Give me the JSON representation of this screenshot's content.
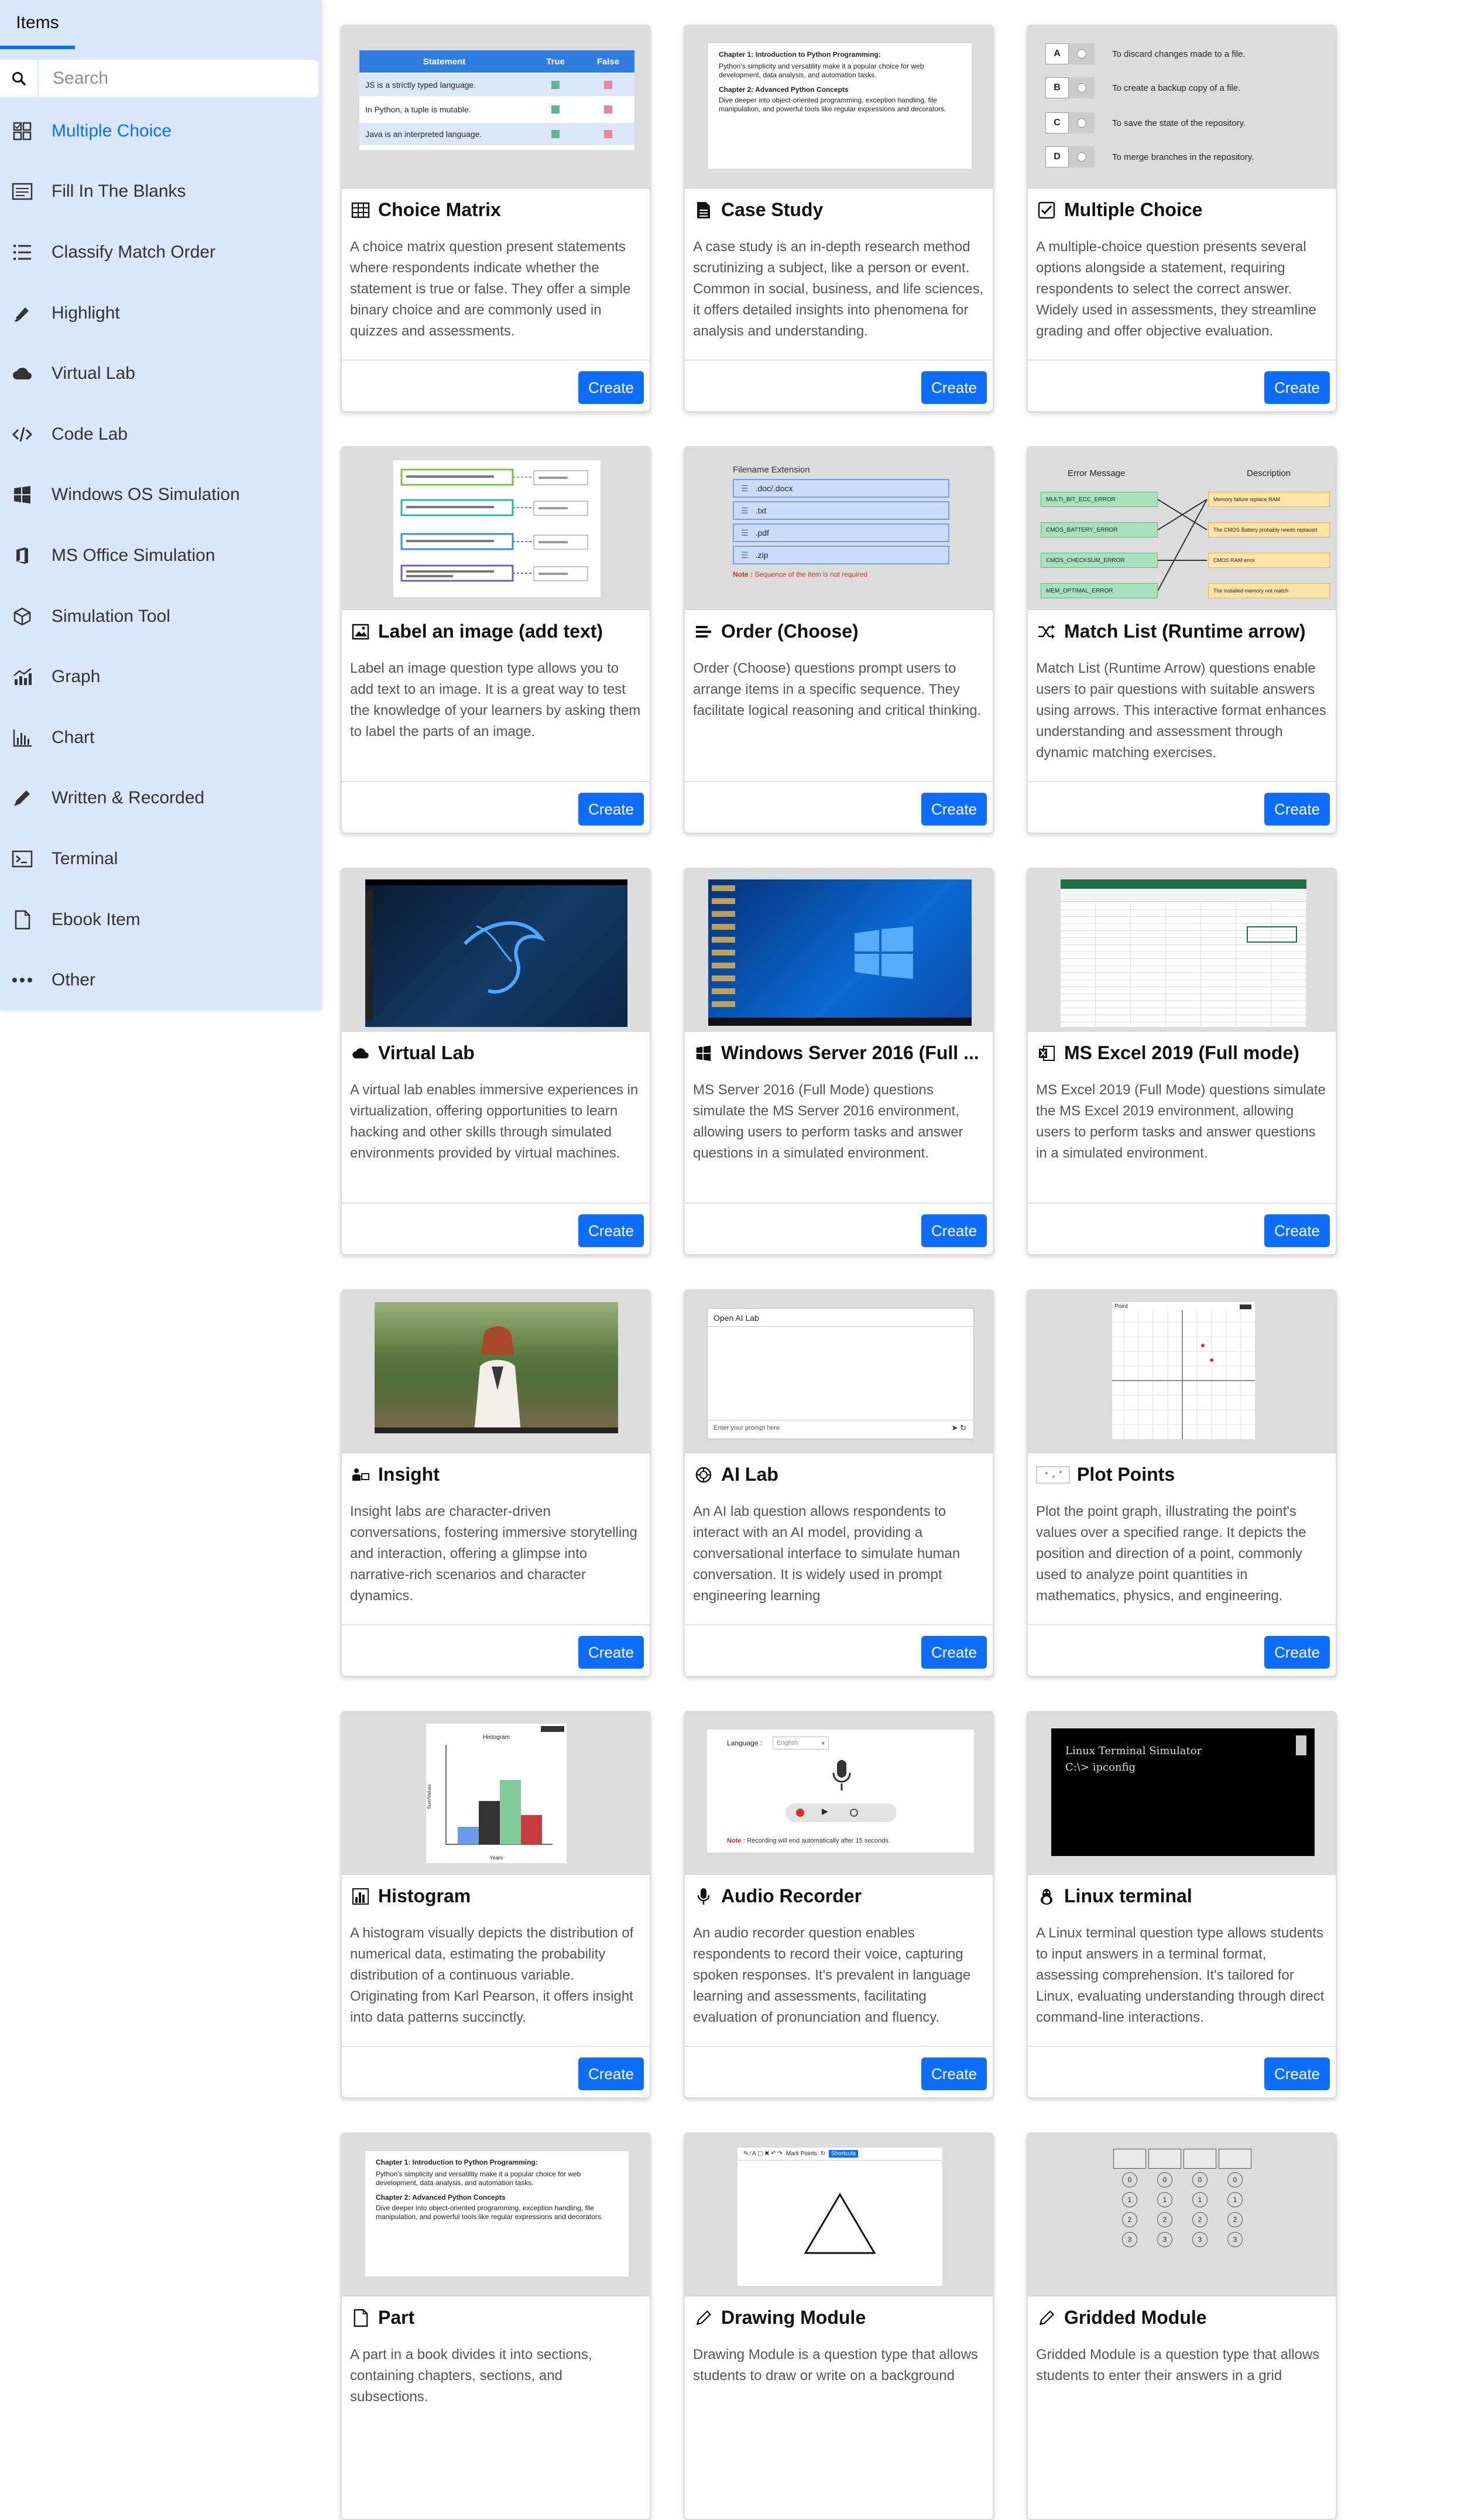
{
  "sidebar": {
    "tab_label": "Items",
    "search": {
      "placeholder": "Search",
      "icon": "search-icon"
    },
    "items": [
      {
        "label": "Multiple Choice",
        "icon": "multiple-choice-icon",
        "active": true
      },
      {
        "label": "Fill In The Blanks",
        "icon": "fill-blanks-icon"
      },
      {
        "label": "Classify Match Order",
        "icon": "list-icon"
      },
      {
        "label": "Highlight",
        "icon": "highlighter-icon"
      },
      {
        "label": "Virtual Lab",
        "icon": "cloud-icon"
      },
      {
        "label": "Code Lab",
        "icon": "code-icon"
      },
      {
        "label": "Windows OS Simulation",
        "icon": "windows-icon"
      },
      {
        "label": "MS Office Simulation",
        "icon": "office-icon"
      },
      {
        "label": "Simulation Tool",
        "icon": "cube-icon"
      },
      {
        "label": "Graph",
        "icon": "graph-icon"
      },
      {
        "label": "Chart",
        "icon": "chart-icon"
      },
      {
        "label": "Written & Recorded",
        "icon": "pencil-icon"
      },
      {
        "label": "Terminal",
        "icon": "terminal-icon"
      },
      {
        "label": "Ebook Item",
        "icon": "page-icon"
      },
      {
        "label": "Other",
        "icon": "more-icon"
      }
    ]
  },
  "create_label": "Create",
  "cards": [
    {
      "title": "Choice Matrix",
      "icon": "table-icon",
      "desc": "A choice matrix question present statements where respondents indicate whether the statement is true or false. They offer a simple binary choice and are commonly used in quizzes and assessments."
    },
    {
      "title": "Case Study",
      "icon": "document-icon",
      "desc": "A case study is an in-depth research method scrutinizing a subject, like a person or event. Common in social, business, and life sciences, it offers detailed insights into phenomena for analysis and understanding."
    },
    {
      "title": "Multiple Choice",
      "icon": "checkbox-icon",
      "desc": "A multiple-choice question presents several options alongside a statement, requiring respondents to select the correct answer. Widely used in assessments, they streamline grading and offer objective evaluation."
    },
    {
      "title": "Label an image (add text)",
      "icon": "image-icon",
      "desc": "Label an image question type allows you to add text to an image. It is a great way to test the knowledge of your learners by asking them to label the parts of an image."
    },
    {
      "title": "Order (Choose)",
      "icon": "order-list-icon",
      "desc": "Order (Choose) questions prompt users to arrange items in a specific sequence. They facilitate logical reasoning and critical thinking."
    },
    {
      "title": "Match List (Runtime arrow)",
      "icon": "shuffle-icon",
      "desc": "Match List (Runtime Arrow) questions enable users to pair questions with suitable answers using arrows. This interactive format enhances understanding and assessment through dynamic matching exercises."
    },
    {
      "title": "Virtual Lab",
      "icon": "cloud-icon",
      "desc": "A virtual lab enables immersive experiences in virtualization, offering opportunities to learn hacking and other skills through simulated environments provided by virtual machines."
    },
    {
      "title": "Windows Server 2016 (Full ...",
      "icon": "windows-icon",
      "desc": "MS Server 2016 (Full Mode) questions simulate the MS Server 2016 environment, allowing users to perform tasks and answer questions in a simulated environment."
    },
    {
      "title": "MS Excel 2019 (Full mode)",
      "icon": "excel-icon",
      "desc": "MS Excel 2019 (Full Mode) questions simulate the MS Excel 2019 environment, allowing users to perform tasks and answer questions in a simulated environment."
    },
    {
      "title": "Insight",
      "icon": "insight-icon",
      "desc": "Insight labs are character-driven conversations, fostering immersive storytelling and interaction, offering a glimpse into narrative-rich scenarios and character dynamics."
    },
    {
      "title": "AI Lab",
      "icon": "ai-icon",
      "desc": "An AI lab question allows respondents to interact with an AI model, providing a conversational interface to simulate human conversation. It is widely used in prompt engineering learning"
    },
    {
      "title": "Plot Points",
      "icon": "plot-points-icon",
      "desc": "Plot the point graph, illustrating the point's values over a specified range. It depicts the position and direction of a point, commonly used to analyze point quantities in mathematics, physics, and engineering."
    },
    {
      "title": "Histogram",
      "icon": "histogram-icon",
      "desc": "A histogram visually depicts the distribution of numerical data, estimating the probability distribution of a continuous variable. Originating from Karl Pearson, it offers insight into data patterns succinctly."
    },
    {
      "title": "Audio Recorder",
      "icon": "microphone-icon",
      "desc": "An audio recorder question enables respondents to record their voice, capturing spoken responses. It's prevalent in language learning and assessments, facilitating evaluation of pronunciation and fluency."
    },
    {
      "title": "Linux terminal",
      "icon": "linux-icon",
      "desc": "A Linux terminal question type allows students to input answers in a terminal format, assessing comprehension. It's tailored for Linux, evaluating understanding through direct command-line interactions."
    },
    {
      "title": "Part",
      "icon": "page-icon",
      "desc": "A part in a book divides it into sections, containing chapters, sections, and subsections."
    },
    {
      "title": "Drawing Module",
      "icon": "pen-icon",
      "desc": "Drawing Module is a question type that allows students to draw or write on a background"
    },
    {
      "title": "Gridded Module",
      "icon": "pen-icon",
      "desc": "Gridded Module is a question type that allows students to enter their answers in a grid"
    }
  ],
  "thumbs": {
    "choice_matrix": {
      "headers": [
        "Statement",
        "True",
        "False"
      ],
      "rows": [
        "JS is a strictly typed language.",
        "In Python, a tuple is mutable.",
        "Java is an interpreted language."
      ]
    },
    "case_study": {
      "ch1": "Chapter 1: Introduction to Python Programming:",
      "ch1_text": "Python's simplicity and versatility make it a popular choice for web development, data analysis, and automation tasks.",
      "ch2": "Chapter 2: Advanced Python Concepts",
      "ch2_text": "Dive deeper into object-oriented programming, exception handling, file manipulation, and powerful tools like regular expressions and decorators."
    },
    "multiple_choice": {
      "options": [
        {
          "key": "A",
          "text": "To discard changes made to a file."
        },
        {
          "key": "B",
          "text": "To create a backup copy of a file."
        },
        {
          "key": "C",
          "text": "To save the state of the repository."
        },
        {
          "key": "D",
          "text": "To merge branches in the repository."
        }
      ]
    },
    "order": {
      "title": "Filename Extension",
      "items": [
        ".doc/.docx",
        ".txt",
        ".pdf",
        ".zip"
      ],
      "note_label": "Note :",
      "note": "Sequence of the item is not required"
    },
    "match": {
      "col1": "Error Message",
      "col2": "Description",
      "left": [
        "MULTI_BIT_ECC_ERROR",
        "CMOS_BATTERY_ERROR",
        "CMOS_CHECKSUM_ERROR",
        "MEM_OPTIMAL_ERROR"
      ],
      "right": [
        "Memory failure replace RAM",
        "The CMOS Battery probably needs replaced",
        "CMOS RAM error",
        "The installed memory not match"
      ]
    },
    "ai_lab": {
      "title": "Open AI Lab",
      "prompt": "Enter your prompt here"
    },
    "plot": {
      "label": "Point"
    },
    "histogram": {
      "title": "Histogram",
      "xlabel": "Years",
      "ylabel": "Sum/Values"
    },
    "audio": {
      "label": "Language :",
      "value": "English",
      "note_label": "Note :",
      "note": "Recording will end automatically after 15 seconds."
    },
    "linux": {
      "line1": "Linux Terminal Simulator",
      "line2": "C:\\> ipconfig"
    },
    "drawing": {
      "mark_points": "Mark Points",
      "shortcuts": "Shortcuts"
    },
    "gridded": {
      "digits": [
        "0",
        "1",
        "2",
        "3"
      ]
    }
  },
  "colors": {
    "accent": "#0d6efd",
    "sidebar_bg": "#d9e6fb",
    "thumb_bg": "#dcdcdc"
  }
}
